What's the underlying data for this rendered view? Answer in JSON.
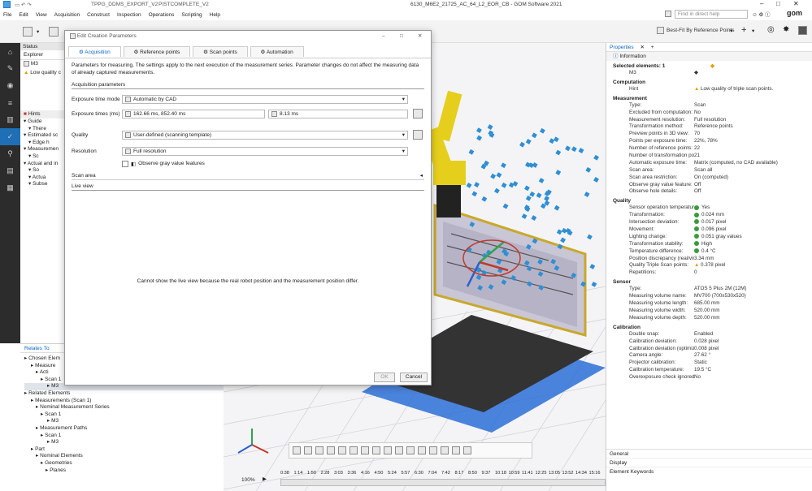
{
  "window": {
    "title": "6130_M6E2_21725_AC_64_L2_EOR_CB - GOM Software 2021",
    "quick_tabs": [
      "TPPG_DDMS_EXPORT_V2",
      "PISTCOMPLETE_V2"
    ],
    "search_placeholder": "Find in direct help",
    "brand": "gom"
  },
  "menu": [
    "File",
    "Edit",
    "View",
    "Acquisition",
    "Construct",
    "Inspection",
    "Operations",
    "Scripting",
    "Help"
  ],
  "toolbar": {
    "alignment": "Best-Fit By Reference Points"
  },
  "explorer": {
    "status_label": "Status",
    "tabs": [
      "Explorer",
      "Pr"
    ],
    "item": "M3",
    "warning": "Low quality c"
  },
  "hints": {
    "title": "Hints",
    "items": [
      "Guide",
      "There",
      "Estimated sc",
      "Edge h",
      "Measuremen",
      "Sc",
      "Actual and in",
      "So",
      "Actua",
      "Subse"
    ]
  },
  "relates": {
    "title": "Relates To",
    "tree": [
      "Chosen Elem",
      "Measure",
      "Acti",
      "Scan 1",
      "M3",
      "Related Elements",
      "Measurements (Scan 1)",
      "Nominal Measurement Series",
      "Scan 1",
      "M3",
      "Measurement Paths",
      "Scan 1",
      "M3",
      "Part",
      "Nominal Elements",
      "Geometries",
      "Planes"
    ]
  },
  "dialog": {
    "title": "Edit Creation Parameters",
    "tabs": [
      "Acquisition",
      "Reference points",
      "Scan points",
      "Automation"
    ],
    "description": "Parameters for measuring. The settings apply to the next execution of the measurement series. Parameter changes do not affect the measuring data of already captured measurements.",
    "section_acq": "Acquisition parameters",
    "exposure_mode_label": "Exposure time mode",
    "exposure_mode_value": "Automatic by CAD",
    "exposure_times_label": "Exposure times (ms)",
    "exposure_times_value": "162.66 ms, 852.40 ms",
    "exposure_extra_value": "8.13 ms",
    "quality_label": "Quality",
    "quality_value": "User-defined (scanning template)",
    "resolution_label": "Resolution",
    "resolution_value": "Full resolution",
    "gray_label": "Observe gray value features",
    "scan_area": "Scan area",
    "live_view": "Live view",
    "live_message": "Cannot show the live view because the real robot position and the measurement position differ.",
    "ok": "OK",
    "cancel": "Cancel"
  },
  "properties": {
    "tab": "Properties",
    "info": "Information",
    "selected_label": "Selected elements: 1",
    "selected_item": "M3",
    "computation": {
      "title": "Computation",
      "hint_label": "Hint",
      "hint_value": "Low quality of triple scan points."
    },
    "measurement": {
      "title": "Measurement",
      "rows": [
        [
          "Type:",
          "Scan"
        ],
        [
          "Excluded from computation:",
          "No"
        ],
        [
          "Measurement resolution:",
          "Full resolution"
        ],
        [
          "Transformation method:",
          "Reference points"
        ],
        [
          "Preview points in 3D view:",
          "70"
        ],
        [
          "Points per exposure time:",
          "22%, 78%"
        ],
        [
          "Number of reference points:",
          "22"
        ],
        [
          "Number of transformation points:",
          "21"
        ],
        [
          "Automatic exposure time:",
          "Matrix (computed, no CAD available)"
        ],
        [
          "Scan area:",
          "Scan all"
        ],
        [
          "Scan area restriction:",
          "On (computed)"
        ],
        [
          "Observe gray value feature:",
          "Off"
        ],
        [
          "Observe hole details:",
          "Off"
        ]
      ]
    },
    "quality": {
      "title": "Quality",
      "rows": [
        [
          "Sensor operation temperature:",
          "Yes"
        ],
        [
          "Transformation:",
          "0.024 mm"
        ],
        [
          "Intersection deviation:",
          "0.017 pixel"
        ],
        [
          "Movement:",
          "0.096 pixel"
        ],
        [
          "Lighting change:",
          "0.051 gray values"
        ],
        [
          "Transformation stability:",
          "High"
        ],
        [
          "Temperature difference:",
          "0.4 °C"
        ],
        [
          "Position discrepancy (real/virtual):",
          "3.34 mm"
        ],
        [
          "Quality Triple Scan points:",
          "0.378 pixel"
        ],
        [
          "Repetitions:",
          "0"
        ]
      ]
    },
    "sensor": {
      "title": "Sensor",
      "rows": [
        [
          "Type:",
          "ATOS 5 Plus 2M (12M)"
        ],
        [
          "Measuring volume name:",
          "MV700 (700x530x520)"
        ],
        [
          "Measuring volume length:",
          "685.00 mm"
        ],
        [
          "Measuring volume width:",
          "520.00 mm"
        ],
        [
          "Measuring volume depth:",
          "520.00 mm"
        ]
      ]
    },
    "calibration": {
      "title": "Calibration",
      "rows": [
        [
          "Double snap:",
          "Enabled"
        ],
        [
          "Calibration deviation:",
          "0.028 pixel"
        ],
        [
          "Calibration deviation (optimized):",
          "0.008 pixel"
        ],
        [
          "Camera angle:",
          "27.62 °"
        ],
        [
          "Projector calibration:",
          "Static"
        ],
        [
          "Calibration temperature:",
          "19.5 °C"
        ],
        [
          "Overexposure check ignored:",
          "No"
        ]
      ]
    },
    "footer": [
      "General",
      "Display",
      "Element Keywords"
    ]
  },
  "viewport": {
    "zoom": "100%",
    "timeline": [
      "0:38",
      "1:14",
      "1:50",
      "2:28",
      "3:03",
      "3:36",
      "4:16",
      "4:50",
      "5:24",
      "5:57",
      "6:30",
      "7:04",
      "7:42",
      "8:17",
      "8:50",
      "9:37",
      "10:18",
      "10:59",
      "11:41",
      "12:25",
      "13:05",
      "13:52",
      "14:34",
      "15:16"
    ]
  }
}
